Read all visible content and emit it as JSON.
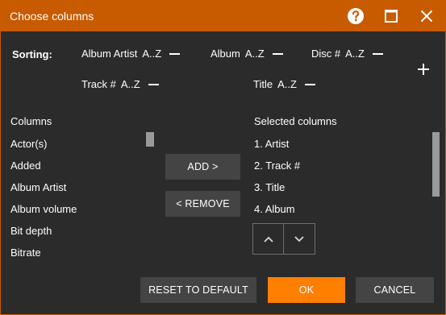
{
  "window": {
    "title": "Choose columns"
  },
  "sorting": {
    "label": "Sorting:",
    "items": [
      {
        "field": "Album Artist",
        "order": "A..Z"
      },
      {
        "field": "Album",
        "order": "A..Z"
      },
      {
        "field": "Disc #",
        "order": "A..Z"
      },
      {
        "field": "Track #",
        "order": "A..Z"
      },
      {
        "field": "Title",
        "order": "A..Z"
      }
    ]
  },
  "columns": {
    "heading": "Columns",
    "items": [
      "Actor(s)",
      "Added",
      "Album Artist",
      "Album volume",
      "Bit depth",
      "Bitrate"
    ]
  },
  "selected": {
    "heading": "Selected columns",
    "items": [
      "1.  Artist",
      "2.  Track #",
      "3.  Title",
      "4.  Album"
    ]
  },
  "buttons": {
    "add": "ADD >",
    "remove": "< REMOVE",
    "reset": "RESET TO DEFAULT",
    "ok": "OK",
    "cancel": "CANCEL"
  },
  "icons": {
    "help": "help-icon",
    "maximize": "maximize-icon",
    "close": "close-icon",
    "plus": "plus-icon",
    "up": "chevron-up-icon",
    "down": "chevron-down-icon"
  },
  "colors": {
    "titlebar": "#c85a00",
    "accent": "#ff7f00",
    "background": "#2b2b2b",
    "button": "#444444"
  }
}
